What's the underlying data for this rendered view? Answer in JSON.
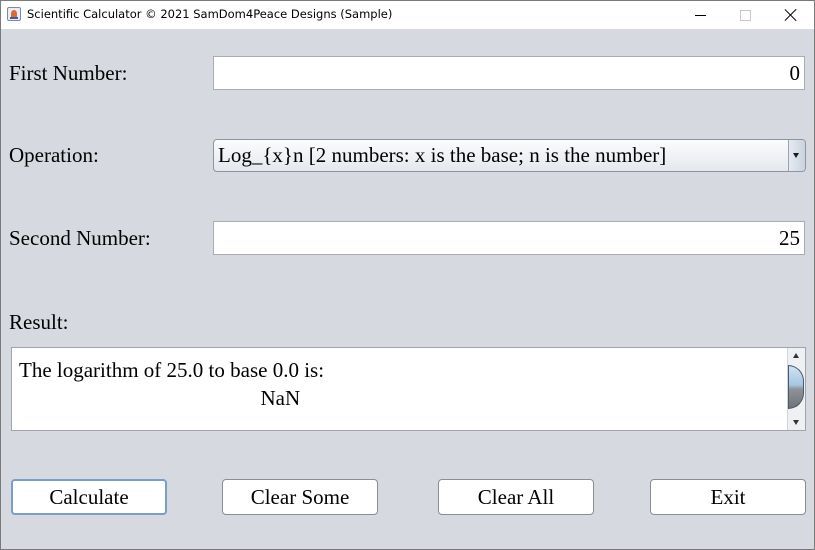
{
  "window": {
    "title": "Scientific Calculator © 2021 SamDom4Peace Designs (Sample)",
    "controls": {
      "minimize": "minimize-icon",
      "maximize": "maximize-icon",
      "close": "close-icon"
    }
  },
  "form": {
    "first_number": {
      "label": "First Number:",
      "value": "0"
    },
    "operation": {
      "label": "Operation:",
      "selected": "Log_{x}n [2 numbers: x is the base; n is the number]"
    },
    "second_number": {
      "label": "Second Number:",
      "value": "25"
    },
    "result": {
      "label": "Result:",
      "text": "The logarithm of 25.0 to base 0.0 is:\n                                              NaN"
    }
  },
  "buttons": {
    "calculate": "Calculate",
    "clear_some": "Clear Some",
    "clear_all": "Clear All",
    "exit": "Exit"
  }
}
